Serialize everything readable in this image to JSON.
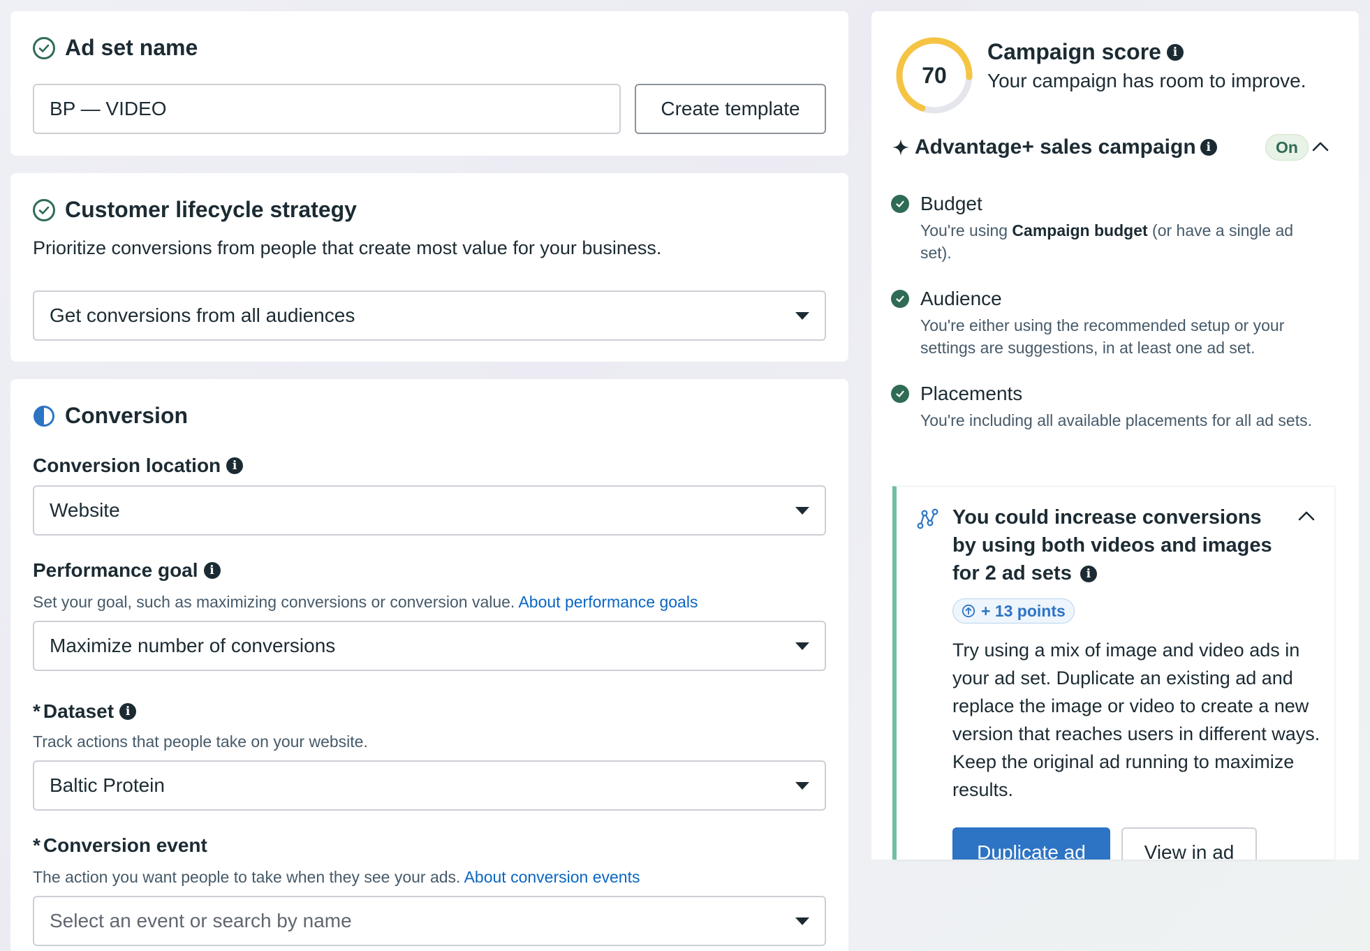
{
  "ad_set": {
    "title": "Ad set name",
    "name_value": "BP — VIDEO",
    "create_template_label": "Create template"
  },
  "lifecycle": {
    "title": "Customer lifecycle strategy",
    "description": "Prioritize conversions from people that create most value for your business.",
    "selected": "Get conversions from all audiences"
  },
  "conversion": {
    "title": "Conversion",
    "location_label": "Conversion location",
    "location_value": "Website",
    "goal_label": "Performance goal",
    "goal_helper": "Set your goal, such as maximizing conversions or conversion value.",
    "goal_link": "About performance goals",
    "goal_value": "Maximize number of conversions",
    "dataset_required": "*",
    "dataset_label": "Dataset",
    "dataset_helper": "Track actions that people take on your website.",
    "dataset_value": "Baltic Protein",
    "event_required": "*",
    "event_label": "Conversion event",
    "event_helper": "The action you want people to take when they see your ads.",
    "event_link": "About conversion events",
    "event_placeholder": "Select an event or search by name"
  },
  "score": {
    "value": "70",
    "value_num": 70,
    "title": "Campaign score",
    "subtitle": "Your campaign has room to improve."
  },
  "advantage": {
    "title": "Advantage+ sales campaign",
    "status": "On",
    "items": [
      {
        "title": "Budget",
        "desc_pre": "You're using ",
        "desc_bold": "Campaign budget",
        "desc_post": " (or have a single ad set)."
      },
      {
        "title": "Audience",
        "desc_pre": "You're either using the recommended setup or your settings are suggestions, in at least one ad set.",
        "desc_bold": "",
        "desc_post": ""
      },
      {
        "title": "Placements",
        "desc_pre": "You're including all available placements for all ad sets.",
        "desc_bold": "",
        "desc_post": ""
      }
    ]
  },
  "recommendation": {
    "title": "You could increase conversions by using both videos and images for 2 ad sets",
    "points": "+ 13 points",
    "body": "Try using a mix of image and video ads in your ad set. Duplicate an existing ad and replace the image or video to create a new version that reaches users in different ways. Keep the original ad running to maximize results.",
    "primary_button": "Duplicate ad",
    "secondary_button": "View in ad"
  },
  "colors": {
    "accent_green": "#2f6b55",
    "link_blue": "#0a66c2",
    "primary_button": "#2d74c4",
    "score_ring": "#f5c443",
    "recommend_bar": "#6fbfa3"
  }
}
